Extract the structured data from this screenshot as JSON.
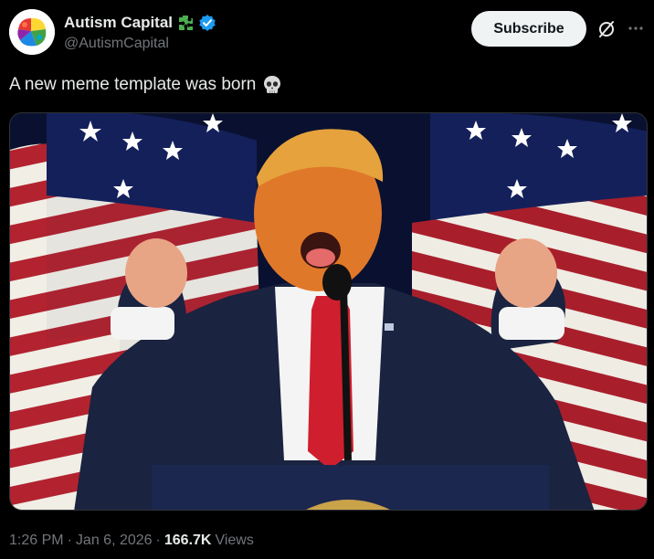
{
  "author": {
    "display_name": "Autism Capital",
    "handle": "@AutismCapital",
    "avatar_icon": "puzzle-brain-avatar-icon",
    "affiliation_icon": "green-puzzle-icon",
    "verified_icon": "verified-badge-icon",
    "verified_color": "#1d9bf0"
  },
  "actions": {
    "subscribe_label": "Subscribe",
    "grok_icon": "grok-icon",
    "more_icon": "more-dots-icon"
  },
  "tweet": {
    "text": "A new meme template was born",
    "emoji_icon": "skull-emoji-icon"
  },
  "media": {
    "type": "video-still",
    "description_icon": "speaker-at-podium-image"
  },
  "meta": {
    "time": "1:26 PM",
    "separator": "·",
    "date": "Jan 6, 2026",
    "views_count": "166.7K",
    "views_label": "Views"
  },
  "colors": {
    "background": "#000000",
    "text_primary": "#e7e9ea",
    "text_secondary": "#71767b",
    "button_bg": "#eff3f4",
    "button_text": "#0f1419"
  }
}
